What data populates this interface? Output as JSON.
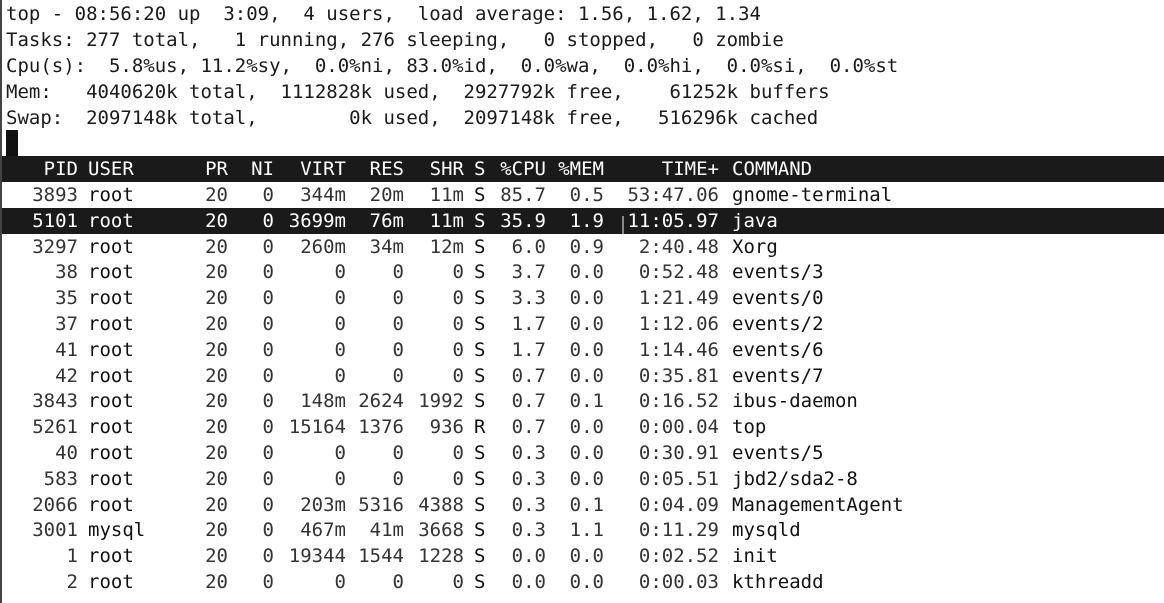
{
  "summary": {
    "line1": "top - 08:56:20 up  3:09,  4 users,  load average: 1.56, 1.62, 1.34",
    "line2": "Tasks: 277 total,   1 running, 276 sleeping,   0 stopped,   0 zombie",
    "line3": "Cpu(s):  5.8%us, 11.2%sy,  0.0%ni, 83.0%id,  0.0%wa,  0.0%hi,  0.0%si,  0.0%st",
    "line4": "Mem:   4040620k total,  1112828k used,  2927792k free,    61252k buffers",
    "line5": "Swap:  2097148k total,        0k used,  2097148k free,   516296k cached"
  },
  "table": {
    "headers": {
      "pid": "PID",
      "user": "USER",
      "pr": "PR",
      "ni": "NI",
      "virt": "VIRT",
      "res": "RES",
      "shr": "SHR",
      "s": "S",
      "cpu": "%CPU",
      "mem": "%MEM",
      "time": "TIME+",
      "command": "COMMAND"
    },
    "rows": [
      {
        "pid": "3893",
        "user": "root",
        "pr": "20",
        "ni": "0",
        "virt": "344m",
        "res": "20m",
        "shr": "11m",
        "s": "S",
        "cpu": "85.7",
        "mem": "0.5",
        "time": "53:47.06",
        "command": "gnome-terminal"
      },
      {
        "pid": "5101",
        "user": "root",
        "pr": "20",
        "ni": "0",
        "virt": "3699m",
        "res": "76m",
        "shr": "11m",
        "s": "S",
        "cpu": "35.9",
        "mem": "1.9",
        "time": "11:05.97",
        "command": "java"
      },
      {
        "pid": "3297",
        "user": "root",
        "pr": "20",
        "ni": "0",
        "virt": "260m",
        "res": "34m",
        "shr": "12m",
        "s": "S",
        "cpu": "6.0",
        "mem": "0.9",
        "time": "2:40.48",
        "command": "Xorg"
      },
      {
        "pid": "38",
        "user": "root",
        "pr": "20",
        "ni": "0",
        "virt": "0",
        "res": "0",
        "shr": "0",
        "s": "S",
        "cpu": "3.7",
        "mem": "0.0",
        "time": "0:52.48",
        "command": "events/3"
      },
      {
        "pid": "35",
        "user": "root",
        "pr": "20",
        "ni": "0",
        "virt": "0",
        "res": "0",
        "shr": "0",
        "s": "S",
        "cpu": "3.3",
        "mem": "0.0",
        "time": "1:21.49",
        "command": "events/0"
      },
      {
        "pid": "37",
        "user": "root",
        "pr": "20",
        "ni": "0",
        "virt": "0",
        "res": "0",
        "shr": "0",
        "s": "S",
        "cpu": "1.7",
        "mem": "0.0",
        "time": "1:12.06",
        "command": "events/2"
      },
      {
        "pid": "41",
        "user": "root",
        "pr": "20",
        "ni": "0",
        "virt": "0",
        "res": "0",
        "shr": "0",
        "s": "S",
        "cpu": "1.7",
        "mem": "0.0",
        "time": "1:14.46",
        "command": "events/6"
      },
      {
        "pid": "42",
        "user": "root",
        "pr": "20",
        "ni": "0",
        "virt": "0",
        "res": "0",
        "shr": "0",
        "s": "S",
        "cpu": "0.7",
        "mem": "0.0",
        "time": "0:35.81",
        "command": "events/7"
      },
      {
        "pid": "3843",
        "user": "root",
        "pr": "20",
        "ni": "0",
        "virt": "148m",
        "res": "2624",
        "shr": "1992",
        "s": "S",
        "cpu": "0.7",
        "mem": "0.1",
        "time": "0:16.52",
        "command": "ibus-daemon"
      },
      {
        "pid": "5261",
        "user": "root",
        "pr": "20",
        "ni": "0",
        "virt": "15164",
        "res": "1376",
        "shr": "936",
        "s": "R",
        "cpu": "0.7",
        "mem": "0.0",
        "time": "0:00.04",
        "command": "top"
      },
      {
        "pid": "40",
        "user": "root",
        "pr": "20",
        "ni": "0",
        "virt": "0",
        "res": "0",
        "shr": "0",
        "s": "S",
        "cpu": "0.3",
        "mem": "0.0",
        "time": "0:30.91",
        "command": "events/5"
      },
      {
        "pid": "583",
        "user": "root",
        "pr": "20",
        "ni": "0",
        "virt": "0",
        "res": "0",
        "shr": "0",
        "s": "S",
        "cpu": "0.3",
        "mem": "0.0",
        "time": "0:05.51",
        "command": "jbd2/sda2-8"
      },
      {
        "pid": "2066",
        "user": "root",
        "pr": "20",
        "ni": "0",
        "virt": "203m",
        "res": "5316",
        "shr": "4388",
        "s": "S",
        "cpu": "0.3",
        "mem": "0.1",
        "time": "0:04.09",
        "command": "ManagementAgent"
      },
      {
        "pid": "3001",
        "user": "mysql",
        "pr": "20",
        "ni": "0",
        "virt": "467m",
        "res": "41m",
        "shr": "3668",
        "s": "S",
        "cpu": "0.3",
        "mem": "1.1",
        "time": "0:11.29",
        "command": "mysqld"
      },
      {
        "pid": "1",
        "user": "root",
        "pr": "20",
        "ni": "0",
        "virt": "19344",
        "res": "1544",
        "shr": "1228",
        "s": "S",
        "cpu": "0.0",
        "mem": "0.0",
        "time": "0:02.52",
        "command": "init"
      },
      {
        "pid": "2",
        "user": "root",
        "pr": "20",
        "ni": "0",
        "virt": "0",
        "res": "0",
        "shr": "0",
        "s": "S",
        "cpu": "0.0",
        "mem": "0.0",
        "time": "0:00.03",
        "command": "kthreadd"
      }
    ]
  }
}
